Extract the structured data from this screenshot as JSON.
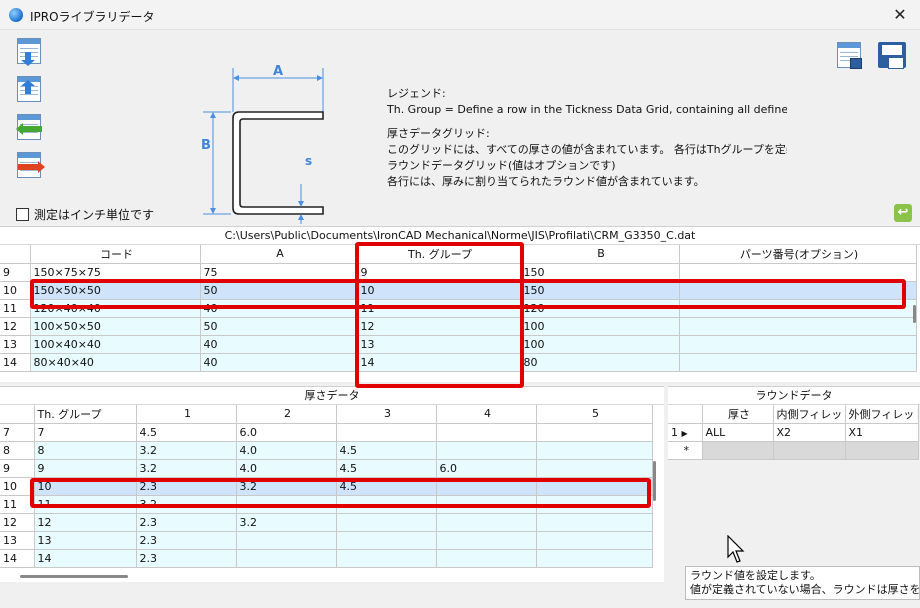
{
  "window": {
    "title": "IPROライブラリデータ",
    "close_glyph": "✕"
  },
  "toolbar": {
    "left_buttons": [
      "insert-row-below-icon",
      "insert-row-above-icon",
      "add-row-icon",
      "delete-row-icon"
    ],
    "right_buttons": [
      "save-table-icon",
      "export-table-icon"
    ]
  },
  "profile": {
    "label_a": "A",
    "label_b": "B",
    "label_s": "s"
  },
  "legend": {
    "heading": "レジェンド:",
    "line1": "Th. Group = Define a row in the Tickness Data Grid, containing all defined values",
    "heading2": "厚さデータグリッド:",
    "line2": "このグリッドには、すべての厚さの値が含まれています。 各行はThグループを定義しま",
    "line3": "ラウンドデータグリッド(値はオプションです)",
    "line4": "各行には、厚みに割り当てられたラウンド値が含まれています。"
  },
  "options": {
    "inch_label": "測定はインチ単位です",
    "inch_checked": false
  },
  "main_grid": {
    "file_path": "C:\\Users\\Public\\Documents\\IronCAD Mechanical\\Norme\\JIS\\Profilati\\CRM_G3350_C.dat",
    "headers": [
      "コード",
      "A",
      "Th. グループ",
      "B",
      "パーツ番号(オプション)"
    ],
    "rows": [
      {
        "num": "9",
        "cells": [
          "150×75×75",
          "75",
          "9",
          "150",
          ""
        ]
      },
      {
        "num": "10",
        "cells": [
          "150×50×50",
          "50",
          "10",
          "150",
          ""
        ]
      },
      {
        "num": "11",
        "cells": [
          "120×40×40",
          "40",
          "11",
          "120",
          ""
        ]
      },
      {
        "num": "12",
        "cells": [
          "100×50×50",
          "50",
          "12",
          "100",
          ""
        ]
      },
      {
        "num": "13",
        "cells": [
          "100×40×40",
          "40",
          "13",
          "100",
          ""
        ]
      },
      {
        "num": "14",
        "cells": [
          "80×40×40",
          "40",
          "14",
          "80",
          ""
        ]
      }
    ]
  },
  "thickness_grid": {
    "title": "厚さデータ",
    "headers": [
      "Th. グループ",
      "1",
      "2",
      "3",
      "4",
      "5"
    ],
    "rows": [
      {
        "num": "7",
        "cells": [
          "7",
          "4.5",
          "6.0",
          "",
          "",
          ""
        ]
      },
      {
        "num": "8",
        "cells": [
          "8",
          "3.2",
          "4.0",
          "4.5",
          "",
          ""
        ]
      },
      {
        "num": "9",
        "cells": [
          "9",
          "3.2",
          "4.0",
          "4.5",
          "6.0",
          ""
        ]
      },
      {
        "num": "10",
        "cells": [
          "10",
          "2.3",
          "3.2",
          "4.5",
          "",
          ""
        ]
      },
      {
        "num": "11",
        "cells": [
          "11",
          "3.2",
          "",
          "",
          "",
          ""
        ]
      },
      {
        "num": "12",
        "cells": [
          "12",
          "2.3",
          "3.2",
          "",
          "",
          ""
        ]
      },
      {
        "num": "13",
        "cells": [
          "13",
          "2.3",
          "",
          "",
          "",
          ""
        ]
      },
      {
        "num": "14",
        "cells": [
          "14",
          "2.3",
          "",
          "",
          "",
          ""
        ]
      }
    ]
  },
  "round_grid": {
    "title": "ラウンドデータ",
    "headers": [
      "厚さ",
      "内側フィレット",
      "外側フィレット"
    ],
    "rows": [
      {
        "num": "1",
        "cells": [
          "ALL",
          "X2",
          "X1"
        ]
      }
    ],
    "new_row_marker": "*"
  },
  "tooltip": {
    "line1": "ラウンド値を設定します。",
    "line2": "値が定義されていない場合、ラウンドは厚さを使用"
  },
  "colors": {
    "highlight": "#e00000",
    "selected_row": "#cfe3fb",
    "alt_row": "#e8fbff"
  }
}
